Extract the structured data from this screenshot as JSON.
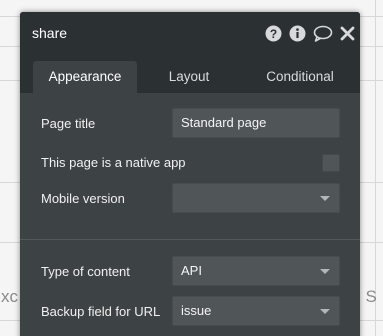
{
  "background": {
    "left_text": "xc",
    "right_text": ", S"
  },
  "panel": {
    "title": "share",
    "icons": [
      "help-icon",
      "info-icon",
      "comment-icon",
      "close-icon"
    ]
  },
  "tabs": [
    {
      "label": "Appearance",
      "active": true
    },
    {
      "label": "Layout",
      "active": false
    },
    {
      "label": "Conditional",
      "active": false
    }
  ],
  "fields": {
    "page_title": {
      "label": "Page title",
      "value": "Standard page"
    },
    "native_app": {
      "label": "This page is a native app",
      "checked": false
    },
    "mobile_version": {
      "label": "Mobile version",
      "value": ""
    },
    "type_of_content": {
      "label": "Type of content",
      "value": "API"
    },
    "backup_field": {
      "label": "Backup field for URL",
      "value": "issue"
    }
  },
  "colors": {
    "panel_bg": "#3d4245",
    "header_bg": "#2b3033",
    "field_bg": "#505558"
  }
}
